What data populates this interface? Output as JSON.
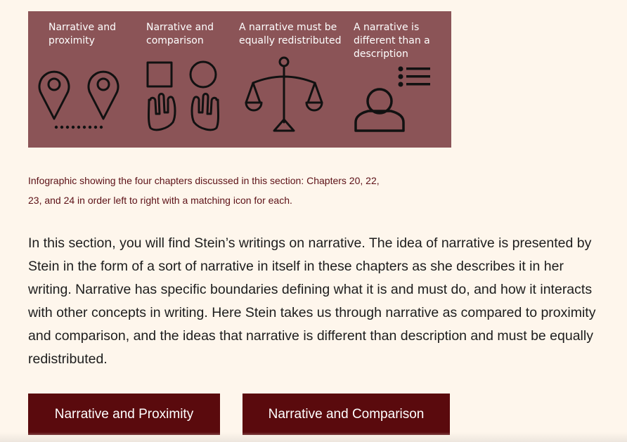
{
  "infographic": {
    "labels": [
      "Narrative and\nproximity",
      "Narrative and\ncomparison",
      "A narrative must be\nequally redistributed",
      "A narrative is\ndifferent than a\ndescription"
    ],
    "icons": [
      "location-pins-icon",
      "shapes-hands-icon",
      "scales-icon",
      "person-list-icon"
    ]
  },
  "caption": "Infographic showing the four chapters discussed in this section: Chapters 20, 22, 23, and 24 in order left to right with a matching icon for each.",
  "intro_text": "In this section, you will find Stein’s writings on narrative. The idea of narrative is presented by Stein in the form of a sort of narrative in itself in these chapters as she describes it in her writing. Narrative has specific boundaries defining what it is and must do, and how it interacts with other concepts in writing. Here Stein takes us through narrative as compared to proximity and comparison, and the ideas that narrative is different than description and must be equally redistributed.",
  "buttons": {
    "proximity": "Narrative and Proximity",
    "comparison": "Narrative and Comparison"
  },
  "colors": {
    "background": "#fef6ec",
    "infographic_bg": "#8b5457",
    "button_bg": "#5a0a0d",
    "caption_text": "#5c1016"
  }
}
